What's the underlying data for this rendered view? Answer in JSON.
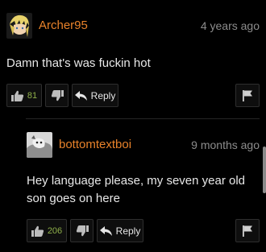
{
  "comments": [
    {
      "username": "Archer95",
      "time": "4 years ago",
      "text": "Damn that's was fuckin hot",
      "likes": "81",
      "reply_label": "Reply",
      "username_color": "#e8822a"
    },
    {
      "username": "bottomtextboi",
      "time": "9 months ago",
      "text": "Hey language please, my seven year old son goes on here",
      "likes": "206",
      "reply_label": "Reply",
      "username_color": "#e8822a"
    }
  ],
  "icons": {
    "like": "thumbs-up-icon",
    "dislike": "thumbs-down-icon",
    "reply": "reply-arrow-icon",
    "flag": "flag-icon"
  },
  "colors": {
    "background": "#000000",
    "accent": "#e8822a",
    "like_count": "#8fb04a"
  }
}
